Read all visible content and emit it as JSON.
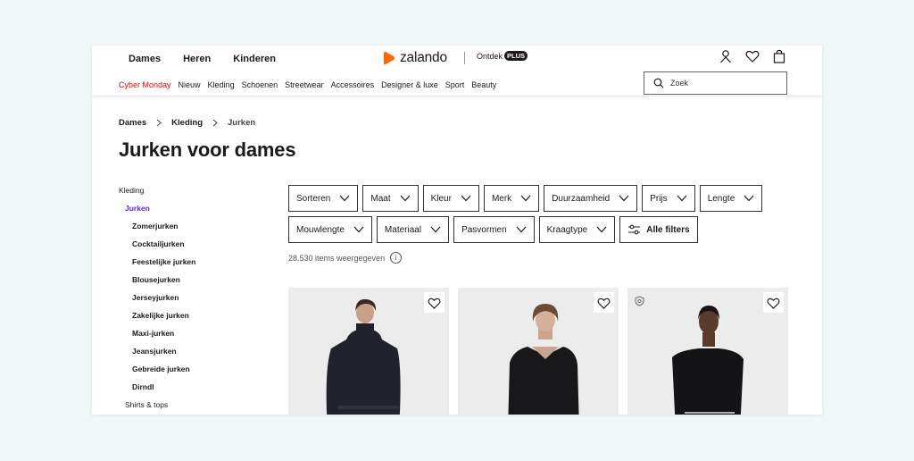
{
  "header": {
    "gender_tabs": [
      "Dames",
      "Heren",
      "Kinderen"
    ],
    "logo_text": "zalando",
    "ontdek_label": "Ontdek",
    "plus_badge": "PLUS",
    "brand_color": "#ff6900",
    "icons": [
      "user-icon",
      "heart-icon",
      "bag-icon"
    ]
  },
  "category_nav": [
    "Cyber Monday",
    "Nieuw",
    "Kleding",
    "Schoenen",
    "Streetwear",
    "Accessoires",
    "Designer & luxe",
    "Sport",
    "Beauty"
  ],
  "search": {
    "placeholder": "Zoek"
  },
  "breadcrumb": [
    "Dames",
    "Kleding",
    "Jurken"
  ],
  "page_title": "Jurken voor dames",
  "sidebar": {
    "parent": "Kleding",
    "active": "Jurken",
    "children": [
      "Zomerjurken",
      "Cocktailjurken",
      "Feestelijke jurken",
      "Blousejurken",
      "Jerseyjurken",
      "Zakelijke jurken",
      "Maxi-jurken",
      "Jeansjurken",
      "Gebreide jurken",
      "Dirndl"
    ],
    "next": "Shirts & tops"
  },
  "filters": {
    "row1": [
      "Sorteren",
      "Maat",
      "Kleur",
      "Merk",
      "Duurzaamheid",
      "Prijs",
      "Lengte"
    ],
    "row2": [
      "Mouwlengte",
      "Materiaal",
      "Pasvormen",
      "Kraagtype"
    ],
    "all_filters": "Alle filters"
  },
  "result_count": "28.530 items weergegeven",
  "products": [
    {
      "image": "woman-in-dark-turtleneck-dress"
    },
    {
      "image": "woman-in-black-v-neck-dress"
    },
    {
      "image": "woman-in-black-dress-with-white-trim",
      "badge": "sustainability-badge-icon"
    }
  ],
  "colors": {
    "accent_red": "#d40a0a",
    "active_purple": "#6328e0"
  }
}
